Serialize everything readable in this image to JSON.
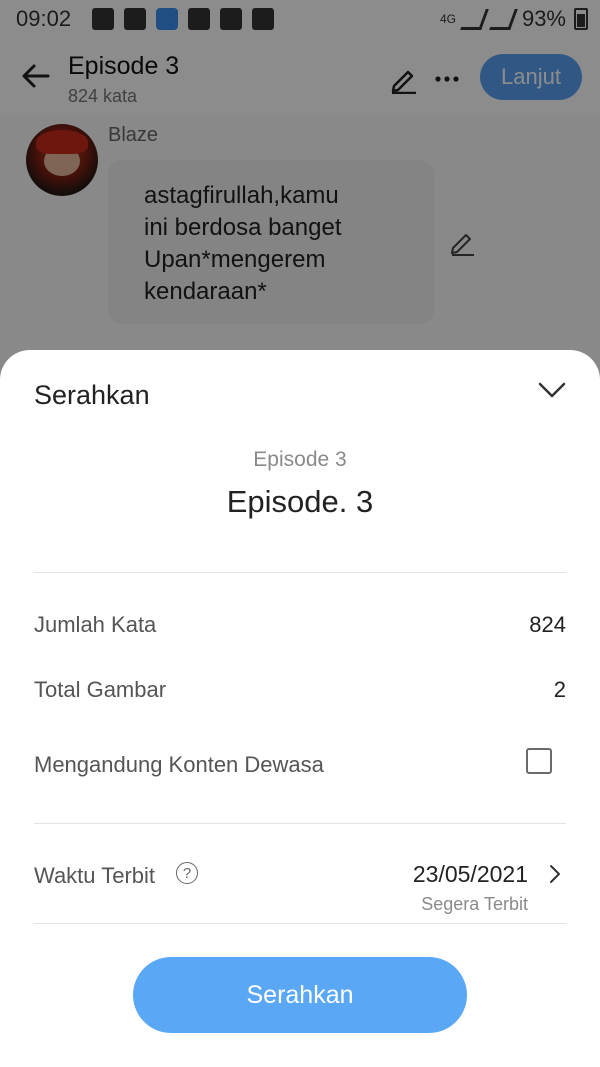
{
  "status_bar": {
    "time": "09:02",
    "network": "4G",
    "battery": "93%"
  },
  "app_bar": {
    "title": "Episode 3",
    "subtitle": "824 kata",
    "next_label": "Lanjut"
  },
  "chat": {
    "sender": "Blaze",
    "message": "astagfirullah,kamu\nini berdosa banget\nUpan*mengerem\nkendaraan*"
  },
  "sheet": {
    "title": "Serahkan",
    "episode_label": "Episode 3",
    "episode_title": "Episode. 3",
    "rows": {
      "word_count_label": "Jumlah Kata",
      "word_count_value": "824",
      "image_count_label": "Total Gambar",
      "image_count_value": "2",
      "adult_label": "Mengandung Konten Dewasa"
    },
    "publish": {
      "label": "Waktu Terbit",
      "help": "?",
      "date": "23/05/2021",
      "sub": "Segera Terbit"
    },
    "submit_label": "Serahkan"
  },
  "colors": {
    "primary": "#5aa8f5",
    "overlay": "rgba(0,0,0,0.45)"
  }
}
